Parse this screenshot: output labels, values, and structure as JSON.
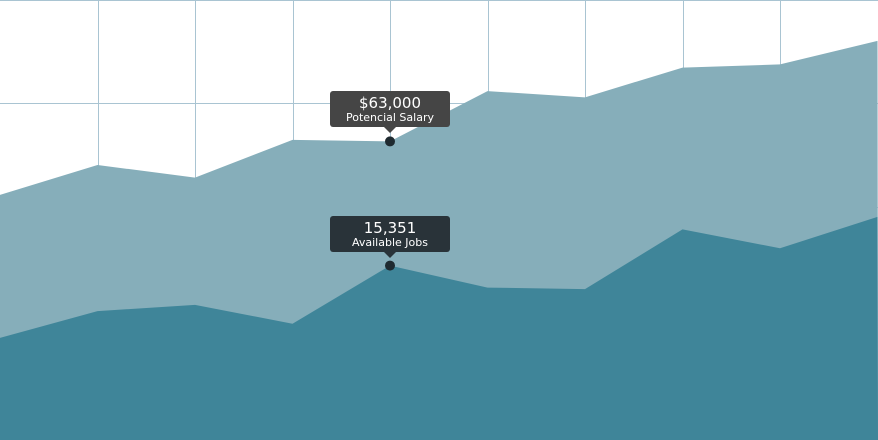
{
  "chart_data": {
    "type": "area",
    "grid": true,
    "series": [
      {
        "key": "salary",
        "color": "#86aeba",
        "values": [
          48,
          57.5,
          53.5,
          65.5,
          65,
          81,
          79,
          88.5,
          89.5,
          97
        ]
      },
      {
        "key": "jobs",
        "color": "#3f8599",
        "values": [
          2.5,
          11,
          13,
          7,
          25.5,
          18.5,
          18,
          37,
          31,
          41
        ]
      }
    ],
    "highlight_index": 4,
    "ylim": [
      -30,
      110
    ]
  },
  "tooltips": {
    "salary": {
      "value": "$63,000",
      "label": "Potencial Salary",
      "color": "#454545"
    },
    "jobs": {
      "value": "15,351",
      "label": "Available Jobs",
      "color": "#293339"
    }
  },
  "colors": {
    "grid": "#a9c4d2",
    "marker": "#1f2a30"
  }
}
